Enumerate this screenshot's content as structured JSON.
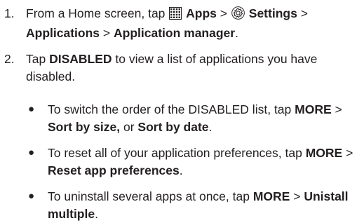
{
  "steps": [
    {
      "number": "1.",
      "line1_a": "From a Home screen, tap",
      "apps_icon": "apps-grid-icon",
      "apps_label": "Apps",
      "sep1": ">",
      "settings_icon": "settings-gear-icon",
      "settings_label": "Settings",
      "sep2": ">",
      "applications": "Applications",
      "sep3": ">",
      "app_manager": "Application manager",
      "end": "."
    },
    {
      "number": "2.",
      "text_a": "Tap",
      "disabled": "DISABLED",
      "text_b": "to view a list of applications you have disabled."
    }
  ],
  "bullets": [
    {
      "text": "To switch the order of the DISABLED list, tap",
      "b1": "MORE",
      "sep": ">",
      "b2": "Sort by size,",
      "mid": "or",
      "b3": "Sort by date",
      "end": "."
    },
    {
      "text": "To reset all of your application preferences, tap",
      "b1": "MORE",
      "sep": ">",
      "b2": "Reset app preferences",
      "end": "."
    },
    {
      "text": "To uninstall several apps at once, tap",
      "b1": "MORE",
      "sep": ">",
      "b2": "Unistall multiple",
      "end": "."
    }
  ],
  "bullet_symbol": "●"
}
